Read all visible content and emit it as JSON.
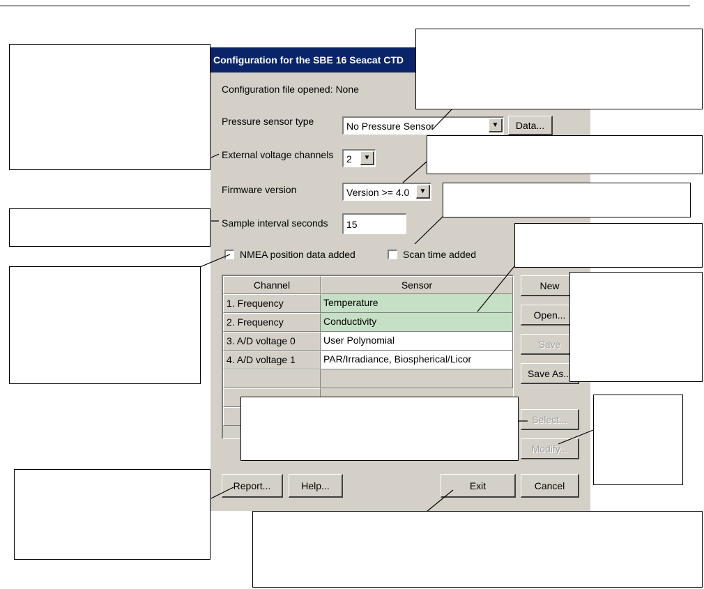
{
  "dialog": {
    "title": "Configuration for the SBE 16 Seacat CTD",
    "config_file_label": "Configuration file opened: None",
    "pressure_label": "Pressure sensor type",
    "pressure_value": "No Pressure Sensor",
    "data_button": "Data...",
    "ext_voltage_label": "External voltage channels",
    "ext_voltage_value": "2",
    "firmware_label": "Firmware version",
    "firmware_value": "Version >= 4.0",
    "sample_label": "Sample interval seconds",
    "sample_value": "15",
    "nmea_label": "NMEA position data added",
    "scan_label": "Scan time added",
    "buttons": {
      "new": "New",
      "open": "Open...",
      "save": "Save",
      "save_as": "Save As...",
      "select": "Select...",
      "modify": "Modify...",
      "report": "Report...",
      "help": "Help...",
      "exit": "Exit",
      "cancel": "Cancel"
    }
  },
  "table": {
    "headers": {
      "channel": "Channel",
      "sensor": "Sensor"
    },
    "rows": [
      {
        "channel": "1. Frequency",
        "sensor": "Temperature"
      },
      {
        "channel": "2. Frequency",
        "sensor": "Conductivity"
      },
      {
        "channel": "3. A/D voltage 0",
        "sensor": "User Polynomial"
      },
      {
        "channel": "4. A/D voltage 1",
        "sensor": "PAR/Irradiance, Biospherical/Licor"
      },
      {
        "channel": "",
        "sensor": ""
      }
    ]
  },
  "icons": {
    "dropdown": "dropdown-arrow-icon"
  }
}
